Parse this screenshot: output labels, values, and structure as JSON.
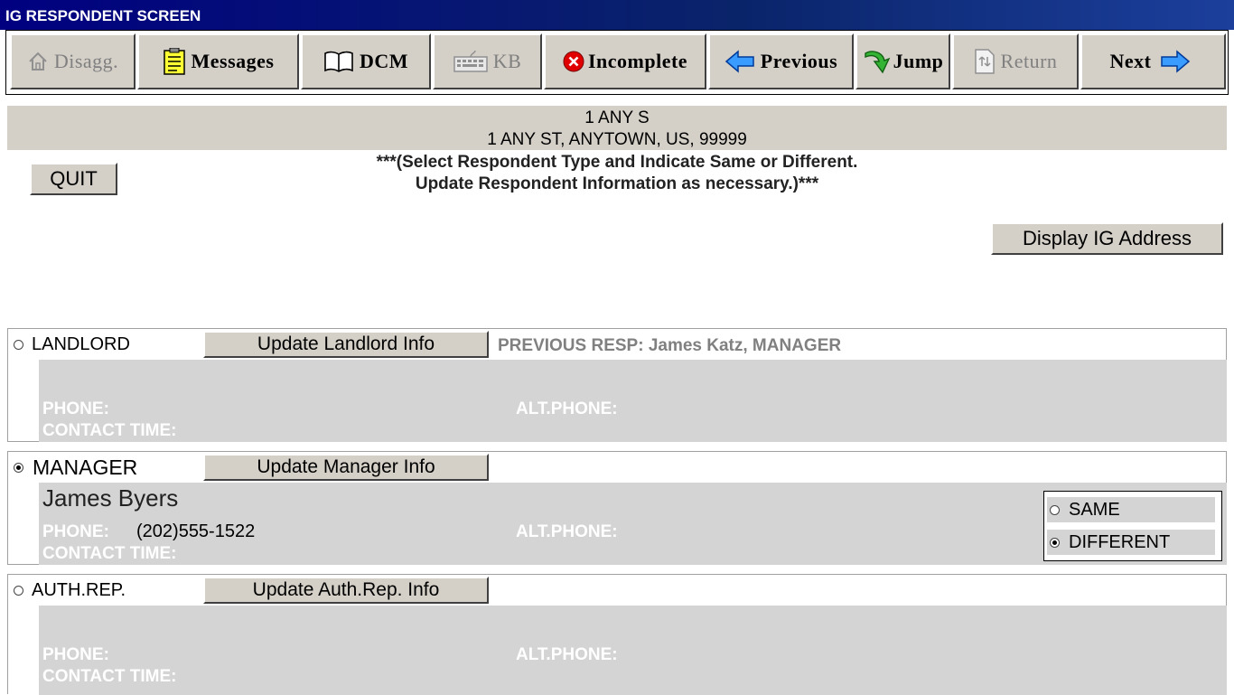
{
  "window": {
    "title": "IG RESPONDENT SCREEN"
  },
  "toolbar": {
    "disagg": "Disagg.",
    "messages": "Messages",
    "dcm": "DCM",
    "kb": "KB",
    "incomplete": "Incomplete",
    "previous": "Previous",
    "jump": "Jump",
    "return": "Return",
    "next": "Next"
  },
  "address": {
    "line1": "1 ANY S",
    "line2": "1 ANY ST, ANYTOWN, US, 99999"
  },
  "quit_label": "QUIT",
  "instructions": {
    "line1": "***(Select Respondent Type and Indicate Same or Different.",
    "line2": "Update Respondent Information as necessary.)***"
  },
  "display_ig_address_label": "Display IG Address",
  "labels": {
    "phone": "PHONE:",
    "alt_phone": "ALT.PHONE:",
    "contact_time": "CONTACT TIME:"
  },
  "respondents": {
    "landlord": {
      "label": "LANDLORD",
      "update_label": "Update Landlord Info",
      "previous_resp": "PREVIOUS RESP: James Katz, MANAGER",
      "selected": false
    },
    "manager": {
      "label": "MANAGER",
      "update_label": "Update Manager Info",
      "name": "James Byers",
      "phone": "(202)555-1522",
      "selected": true
    },
    "auth_rep": {
      "label": "AUTH.REP.",
      "update_label": "Update Auth.Rep. Info",
      "selected": false
    }
  },
  "same_different": {
    "same": "SAME",
    "different": "DIFFERENT",
    "selected": "DIFFERENT"
  },
  "colors": {
    "title_bar": "#0a246a",
    "panel_gray": "#d4d0c8",
    "info_gray": "#d4d4d4",
    "incomplete_icon": "#e00000",
    "arrow_blue": "#2f8fff",
    "jump_green": "#2fa82f"
  }
}
